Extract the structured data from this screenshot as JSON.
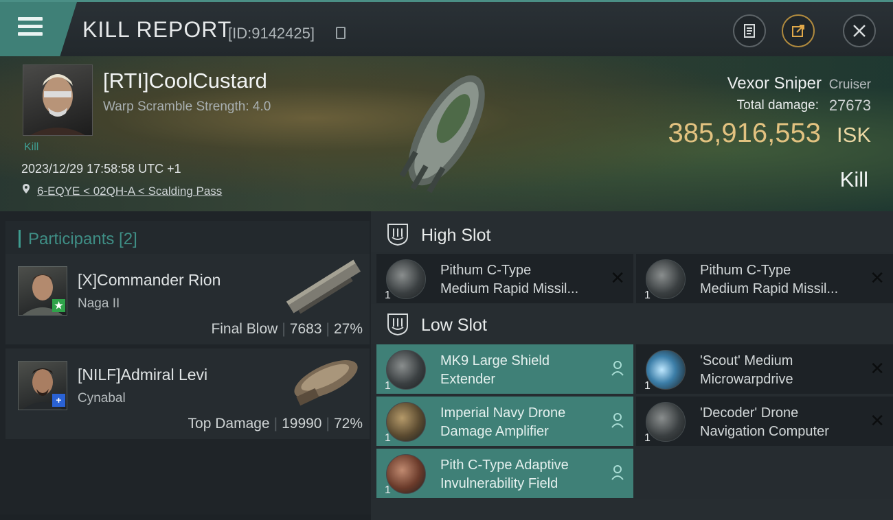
{
  "header": {
    "title": "KILL REPORT",
    "report_id": "[ID:9142425]",
    "icons": [
      "menu-icon",
      "clipboard-icon",
      "share-icon",
      "close-icon"
    ]
  },
  "victim": {
    "name": "[RTI]CoolCustard",
    "warp_scramble": "Warp Scramble Strength: 4.0",
    "kill_tag": "Kill",
    "timestamp": "2023/12/29 17:58:58 UTC +1",
    "location": "6-EQYE < 02QH-A < Scalding Pass",
    "ship_name": "Vexor Sniper",
    "ship_class": "Cruiser",
    "total_damage_label": "Total damage:",
    "total_damage": "27673",
    "isk_value": "385,916,553",
    "isk_label": "ISK",
    "status": "Kill"
  },
  "participants": {
    "title": "Participants [2]",
    "list": [
      {
        "name": "[X]Commander Rion",
        "ship": "Naga II",
        "role": "Final Blow",
        "damage": "7683",
        "percent": "27%",
        "badge": "★",
        "badge_color": "#2fa34a"
      },
      {
        "name": "[NILF]Admiral Levi",
        "ship": "Cynabal",
        "role": "Top Damage",
        "damage": "19990",
        "percent": "72%",
        "badge": "+",
        "badge_color": "#2a62d4"
      }
    ]
  },
  "slots": {
    "high": {
      "title": "High Slot",
      "modules": [
        {
          "qty": "1",
          "line1": "Pithum C-Type",
          "line2": "Medium Rapid Missil..."
        },
        {
          "qty": "1",
          "line1": "Pithum C-Type",
          "line2": "Medium Rapid Missil..."
        }
      ]
    },
    "low": {
      "title": "Low Slot",
      "modules": [
        {
          "qty": "1",
          "line1": "MK9 Large Shield",
          "line2": "Extender"
        },
        {
          "qty": "1",
          "line1": "'Scout' Medium",
          "line2": "Microwarpdrive"
        },
        {
          "qty": "1",
          "line1": "Imperial Navy Drone",
          "line2": "Damage Amplifier"
        },
        {
          "qty": "1",
          "line1": "'Decoder' Drone",
          "line2": "Navigation Computer"
        },
        {
          "qty": "1",
          "line1": "Pith C-Type Adaptive",
          "line2": "Invulnerability Field"
        }
      ]
    }
  },
  "colors": {
    "accent_teal": "#3f8077",
    "isk_gold": "#e2c280",
    "destroyed_x": "#0b0d0e"
  }
}
